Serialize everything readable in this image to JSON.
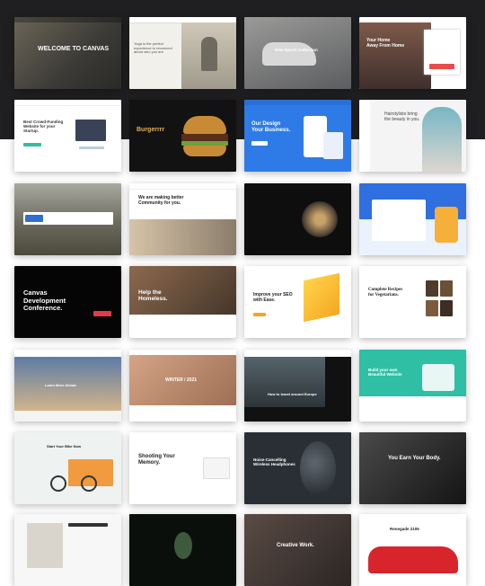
{
  "tiles": [
    {
      "label": "WELCOME TO CANVAS"
    },
    {
      "label": "Yoga is the perfect\nexperience to reconnect\nabout who you are"
    },
    {
      "label": "New Sports Collection"
    },
    {
      "label": "Your Home\nAway From Home"
    },
    {
      "label": "Best Crowd-Funding\nWebsite for your\nStartup."
    },
    {
      "label": "Burgerrrr"
    },
    {
      "label": "Our Design\nYour Business."
    },
    {
      "label": "Hairstylists bring\nthe beauty in you."
    },
    {
      "label": ""
    },
    {
      "label": "We are making better\nCommunity for you."
    },
    {
      "label": ""
    },
    {
      "label": ""
    },
    {
      "label": "Canvas\nDevelopment\nConference."
    },
    {
      "label": "Help the\nHomeless."
    },
    {
      "label": "Improve your SEO\nwith Ease."
    },
    {
      "label": "Complete Recipes\nfor Vegetarians."
    },
    {
      "label": "Learn More Ahead"
    },
    {
      "label": "WINTER / 2021"
    },
    {
      "label": "How to travel around Europe"
    },
    {
      "label": "Build your own\nBeautiful Website"
    },
    {
      "label": "Start Your Bike Now"
    },
    {
      "label": "Shooting Your\nMemory."
    },
    {
      "label": "Noise-Cancelling\nWireless Headphones"
    },
    {
      "label": "You Earn Your Body."
    },
    {
      "label": ""
    },
    {
      "label": ""
    },
    {
      "label": "Creative Work."
    },
    {
      "label": "Renegade 2105"
    }
  ]
}
